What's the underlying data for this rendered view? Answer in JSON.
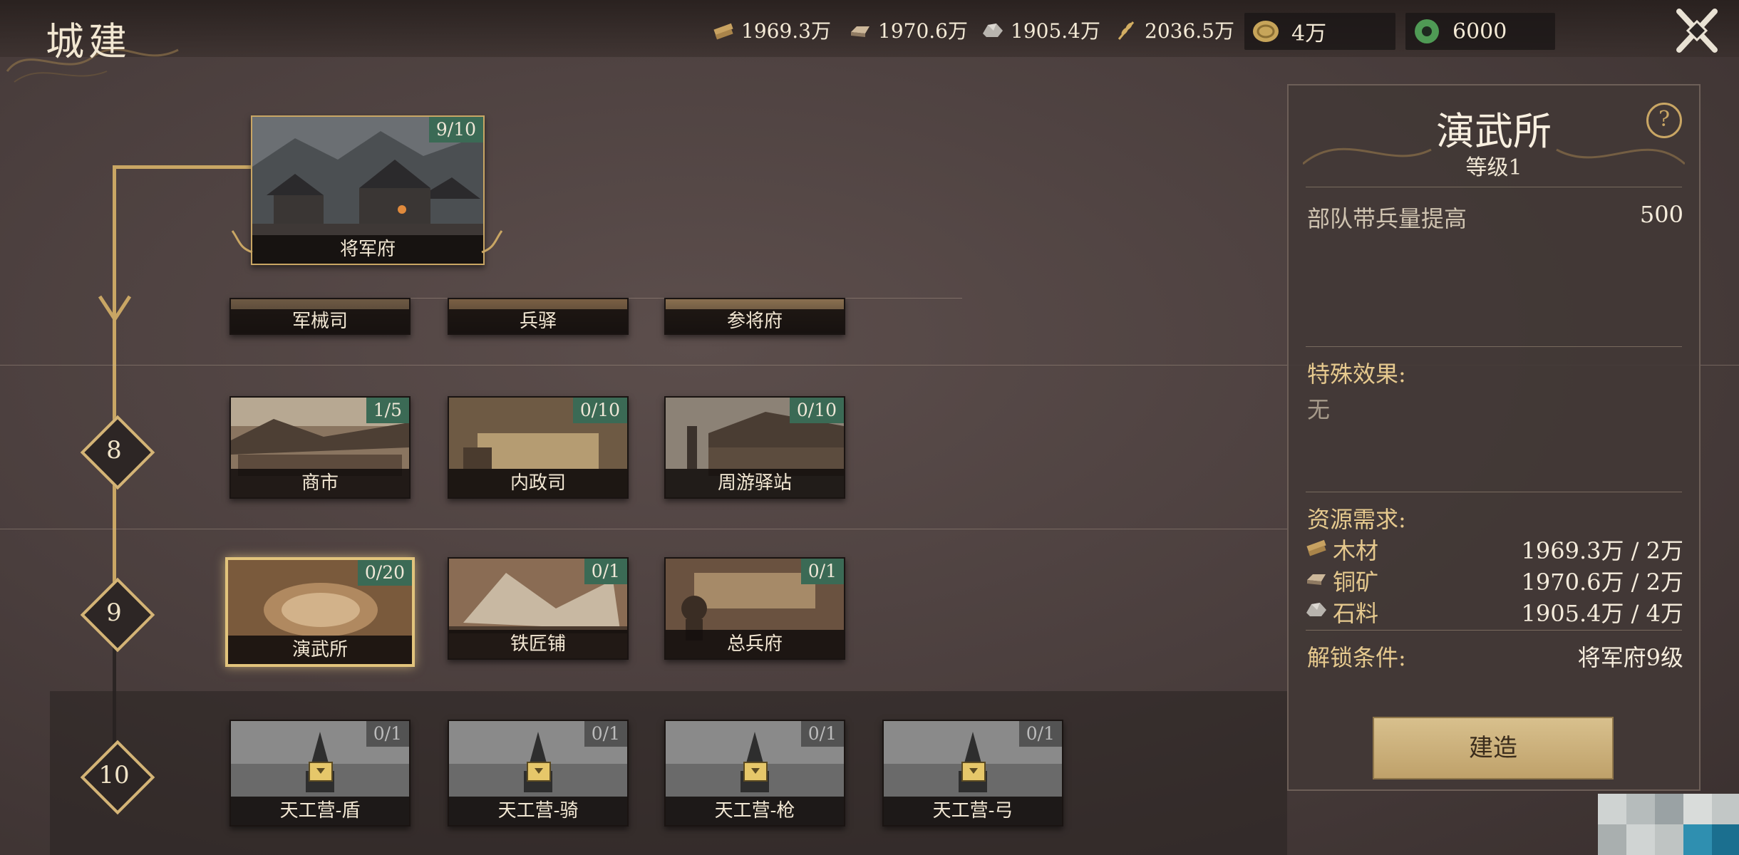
{
  "page": {
    "title": "城建"
  },
  "resources": [
    {
      "icon": "wood-icon",
      "value": "1969.3万"
    },
    {
      "icon": "copper-ingot-icon",
      "value": "1970.6万"
    },
    {
      "icon": "stone-icon",
      "value": "1905.4万"
    },
    {
      "icon": "grain-icon",
      "value": "2036.5万"
    },
    {
      "icon": "gold-coin-icon",
      "value": "4万"
    },
    {
      "icon": "jade-icon",
      "value": "6000"
    }
  ],
  "tree": {
    "levels": [
      "8",
      "9",
      "10"
    ]
  },
  "buildings": {
    "main": {
      "name": "将军府",
      "progress": "9/10"
    },
    "row_top": [
      {
        "name": "军械司"
      },
      {
        "name": "兵驿"
      },
      {
        "name": "参将府"
      }
    ],
    "row_8": [
      {
        "name": "商市",
        "progress": "1/5"
      },
      {
        "name": "内政司",
        "progress": "0/10"
      },
      {
        "name": "周游驿站",
        "progress": "0/10"
      }
    ],
    "row_9": [
      {
        "name": "演武所",
        "progress": "0/20"
      },
      {
        "name": "铁匠铺",
        "progress": "0/1"
      },
      {
        "name": "总兵府",
        "progress": "0/1"
      }
    ],
    "row_10": [
      {
        "name": "天工营-盾",
        "progress": "0/1"
      },
      {
        "name": "天工营-骑",
        "progress": "0/1"
      },
      {
        "name": "天工营-枪",
        "progress": "0/1"
      },
      {
        "name": "天工营-弓",
        "progress": "0/1"
      }
    ]
  },
  "detail": {
    "title": "演武所",
    "level": "等级1",
    "effect_label": "部队带兵量提高",
    "effect_value": "500",
    "special_label": "特殊效果:",
    "special_value": "无",
    "requirements_label": "资源需求:",
    "requirements": [
      {
        "icon": "wood-icon",
        "name": "木材",
        "value": "1969.3万 / 2万"
      },
      {
        "icon": "copper-ingot-icon",
        "name": "铜矿",
        "value": "1970.6万 / 2万"
      },
      {
        "icon": "stone-icon",
        "name": "石料",
        "value": "1905.4万 / 4万"
      }
    ],
    "unlock_label": "解锁条件:",
    "unlock_value": "将军府9级",
    "build_button": "建造",
    "help": "?"
  },
  "colors": {
    "accent_gold": "#c9a664",
    "badge_green": "#3b6a55",
    "button_gold": "#d8c08d"
  }
}
